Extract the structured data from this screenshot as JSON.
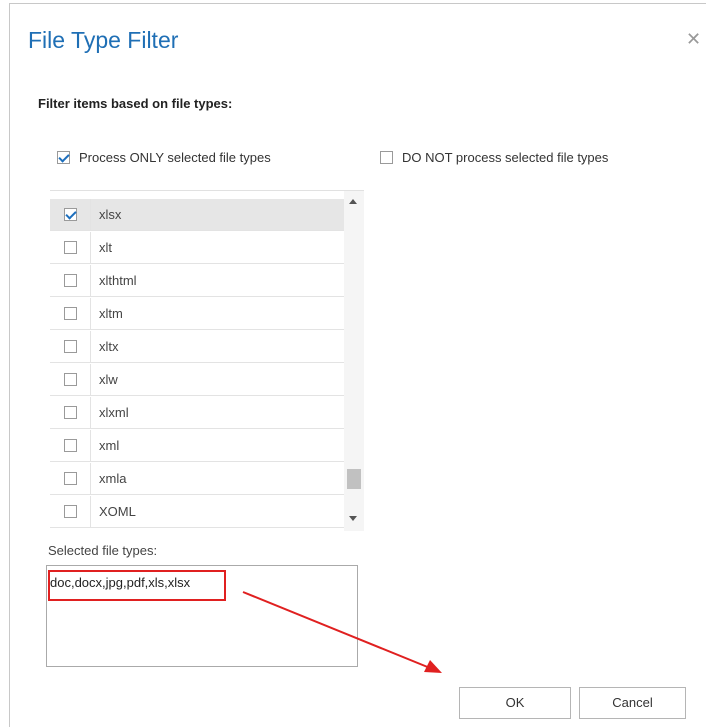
{
  "dialog": {
    "title": "File Type Filter",
    "close_glyph": "✕",
    "subheading": "Filter items based on file types:"
  },
  "options": {
    "process_only": {
      "label": "Process ONLY selected file types",
      "checked": true
    },
    "do_not_process": {
      "label": "DO NOT process selected file types",
      "checked": false
    }
  },
  "file_list": {
    "items": [
      {
        "label": "xlsx",
        "checked": true,
        "selected": true
      },
      {
        "label": "xlt",
        "checked": false
      },
      {
        "label": "xlthtml",
        "checked": false
      },
      {
        "label": "xltm",
        "checked": false
      },
      {
        "label": "xltx",
        "checked": false
      },
      {
        "label": "xlw",
        "checked": false
      },
      {
        "label": "xlxml",
        "checked": false
      },
      {
        "label": "xml",
        "checked": false
      },
      {
        "label": "xmla",
        "checked": false
      },
      {
        "label": "XOML",
        "checked": false
      }
    ]
  },
  "selected": {
    "label": "Selected file types:",
    "value": "doc,docx,jpg,pdf,xls,xlsx"
  },
  "buttons": {
    "ok": "OK",
    "cancel": "Cancel"
  },
  "colors": {
    "title": "#1f6fb5",
    "annotation": "#e02020",
    "selected_row": "#e6e6e6"
  }
}
